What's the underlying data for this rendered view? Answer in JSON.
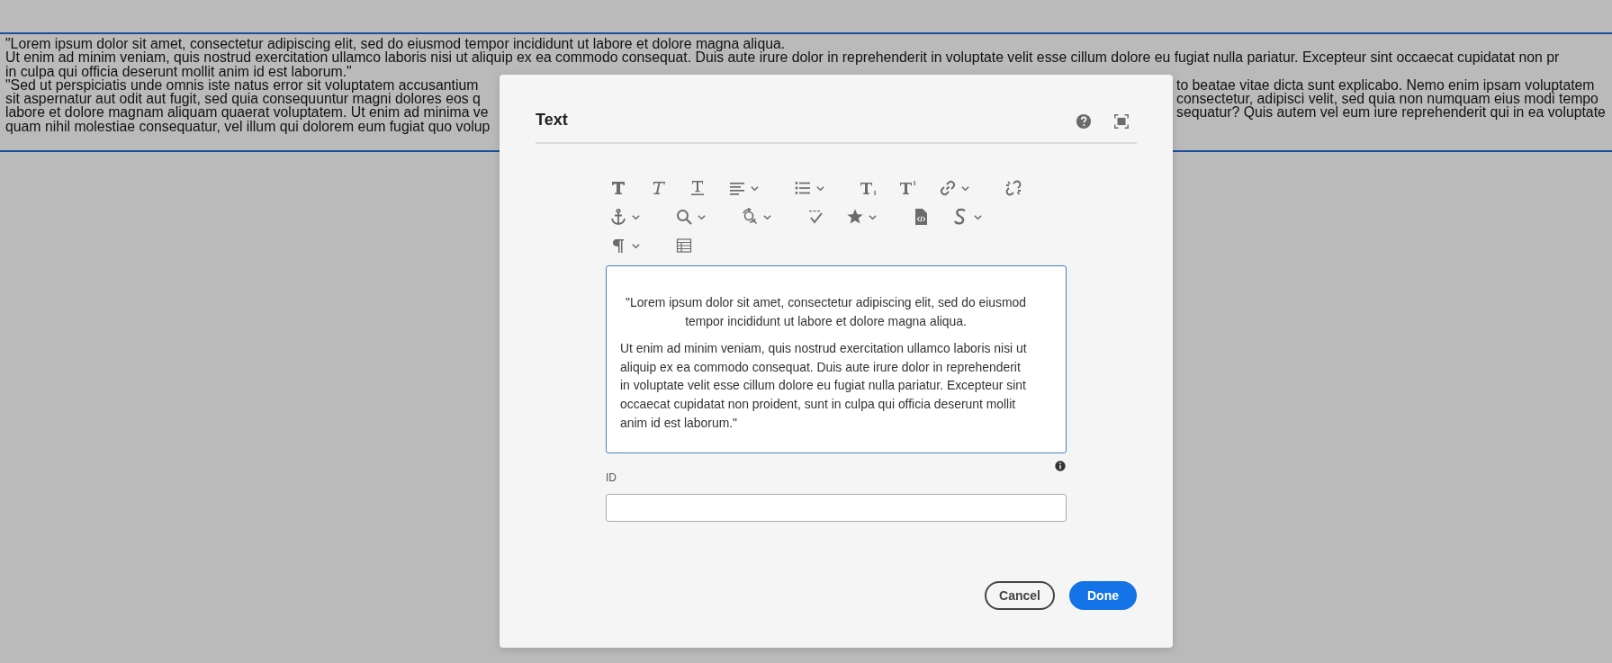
{
  "background_text": {
    "lines": [
      {
        "left": "\"Lorem ipsum dolor sit amet, consectetur adipiscing elit, sed do eiusmod tempor incididunt ut labore et dolore magna aliqua."
      },
      {
        "left": "Ut enim ad minim veniam, quis nostrud exercitation ullamco laboris nisi ut aliquip ex ea commodo consequat. Duis aute irure dolor in reprehenderit in voluptate velit esse cillum dolore eu fugiat nulla pariatur. Excepteur sint occaecat cupidatat non pr"
      },
      {
        "left": "in culpa qui officia deserunt mollit anim id est laborum.\""
      },
      {
        "left": "\"Sed ut perspiciatis unde omnis iste natus error sit voluptatem accusantium",
        "right": "to beatae vitae dicta sunt explicabo. Nemo enim ipsam voluptatem"
      },
      {
        "left": "sit aspernatur aut odit aut fugit, sed quia consequuntur magni dolores eos q",
        "right": "consectetur, adipisci velit, sed quia non numquam eius modi tempo"
      },
      {
        "left": "labore et dolore magnam aliquam quaerat voluptatem. Ut enim ad minima ve",
        "right": "sequatur? Quis autem vel eum iure reprehenderit qui in ea voluptate"
      },
      {
        "left": "quam nihil molestiae consequatur, vel illum qui dolorem eum fugiat quo volup"
      }
    ]
  },
  "dialog": {
    "title": "Text",
    "toolbar": {
      "rows": [
        [
          {
            "kind": "bold",
            "dropdown": false
          },
          {
            "kind": "italic",
            "dropdown": false
          },
          {
            "kind": "underline",
            "dropdown": false
          },
          {
            "kind": "align",
            "dropdown": true
          },
          {
            "kind": "list",
            "dropdown": true
          },
          {
            "kind": "subscript",
            "dropdown": false
          },
          {
            "kind": "superscript",
            "dropdown": false
          },
          {
            "kind": "link",
            "dropdown": true
          },
          {
            "kind": "unlink",
            "dropdown": false
          }
        ],
        [
          {
            "kind": "anchor",
            "dropdown": true
          },
          {
            "kind": "search",
            "dropdown": true
          },
          {
            "kind": "find-replace",
            "dropdown": true
          },
          {
            "kind": "spellcheck",
            "dropdown": false
          },
          {
            "kind": "star",
            "dropdown": true
          },
          {
            "kind": "source",
            "dropdown": false
          },
          {
            "kind": "special-character",
            "dropdown": true
          }
        ],
        [
          {
            "kind": "paragraph",
            "dropdown": true
          },
          {
            "kind": "table",
            "dropdown": false
          }
        ]
      ]
    },
    "editor": {
      "paragraphs": [
        {
          "centered": true,
          "text": "\"Lorem ipsum dolor sit amet, consectetur adipiscing elit, sed do eiusmod tempor incididunt ut labore et dolore magna aliqua."
        },
        {
          "centered": false,
          "text": "Ut enim ad minim veniam, quis nostrud exercitation ullamco laboris nisi ut aliquip ex ea commodo consequat. Duis aute irure dolor in reprehenderit in voluptate velit esse cillum dolore eu fugiat nulla pariatur. Excepteur sint occaecat cupidatat non proident, sunt in culpa qui officia deserunt mollit anim id est laborum.\""
        }
      ]
    },
    "id_field": {
      "label": "ID"
    },
    "buttons": [
      {
        "label": "Cancel",
        "kind": "secondary"
      },
      {
        "label": "Done",
        "kind": "primary"
      }
    ]
  }
}
